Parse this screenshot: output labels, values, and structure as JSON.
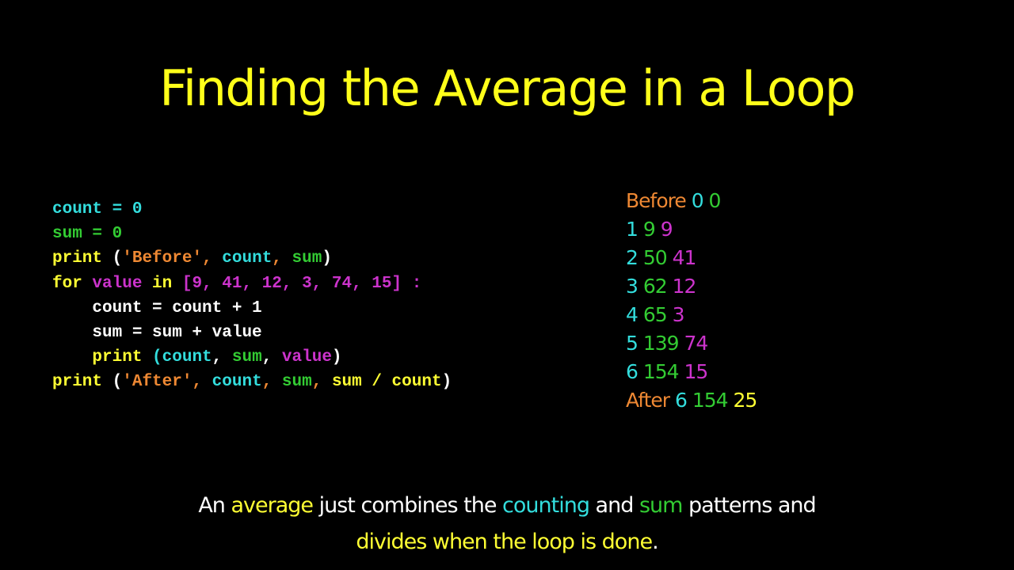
{
  "slide": {
    "title": "Finding the Average in a Loop"
  },
  "colors": {
    "title": "#ffff1a",
    "keyword": "#ffff33",
    "count": "#33dddd",
    "sum": "#33cc33",
    "string": "#ee8833",
    "value": "#cc33cc",
    "plain": "#ffffff"
  },
  "code": {
    "lines": [
      [
        {
          "t": "count = 0",
          "c": "cyan"
        }
      ],
      [
        {
          "t": "sum = 0",
          "c": "green"
        }
      ],
      [
        {
          "t": "print ",
          "c": "yellow"
        },
        {
          "t": "(",
          "c": "white"
        },
        {
          "t": "'Before'",
          "c": "orange"
        },
        {
          "t": ", ",
          "c": "orange"
        },
        {
          "t": "count",
          "c": "cyan"
        },
        {
          "t": ", ",
          "c": "orange"
        },
        {
          "t": "sum",
          "c": "green"
        },
        {
          "t": ")",
          "c": "white"
        }
      ],
      [
        {
          "t": "for ",
          "c": "yellow"
        },
        {
          "t": "value ",
          "c": "magenta"
        },
        {
          "t": "in ",
          "c": "yellow"
        },
        {
          "t": "[9, 41, 12, 3, 74, 15] :",
          "c": "magenta"
        }
      ],
      [
        {
          "t": "    count = count + 1",
          "c": "white"
        }
      ],
      [
        {
          "t": "    sum = sum + value",
          "c": "white"
        }
      ],
      [
        {
          "t": "    print ",
          "c": "yellow"
        },
        {
          "t": "(",
          "c": "cyan"
        },
        {
          "t": "count",
          "c": "cyan"
        },
        {
          "t": ", ",
          "c": "white"
        },
        {
          "t": "sum",
          "c": "green"
        },
        {
          "t": ", ",
          "c": "white"
        },
        {
          "t": "value",
          "c": "magenta"
        },
        {
          "t": ")",
          "c": "white"
        }
      ],
      [
        {
          "t": "print ",
          "c": "yellow"
        },
        {
          "t": "(",
          "c": "white"
        },
        {
          "t": "'After'",
          "c": "orange"
        },
        {
          "t": ", ",
          "c": "orange"
        },
        {
          "t": "count",
          "c": "cyan"
        },
        {
          "t": ", ",
          "c": "orange"
        },
        {
          "t": "sum",
          "c": "green"
        },
        {
          "t": ", ",
          "c": "orange"
        },
        {
          "t": "sum / count",
          "c": "yellow"
        },
        {
          "t": ")",
          "c": "white"
        }
      ]
    ]
  },
  "output": {
    "lines": [
      [
        {
          "t": "Before ",
          "c": "orange"
        },
        {
          "t": "0 ",
          "c": "cyan"
        },
        {
          "t": "0",
          "c": "green"
        }
      ],
      [
        {
          "t": "1 ",
          "c": "cyan"
        },
        {
          "t": "9 ",
          "c": "green"
        },
        {
          "t": "9",
          "c": "magenta"
        }
      ],
      [
        {
          "t": "2 ",
          "c": "cyan"
        },
        {
          "t": "50 ",
          "c": "green"
        },
        {
          "t": "41",
          "c": "magenta"
        }
      ],
      [
        {
          "t": "3 ",
          "c": "cyan"
        },
        {
          "t": "62 ",
          "c": "green"
        },
        {
          "t": "12",
          "c": "magenta"
        }
      ],
      [
        {
          "t": "4 ",
          "c": "cyan"
        },
        {
          "t": "65 ",
          "c": "green"
        },
        {
          "t": "3",
          "c": "magenta"
        }
      ],
      [
        {
          "t": "5 ",
          "c": "cyan"
        },
        {
          "t": "139 ",
          "c": "green"
        },
        {
          "t": "74",
          "c": "magenta"
        }
      ],
      [
        {
          "t": "6 ",
          "c": "cyan"
        },
        {
          "t": "154 ",
          "c": "green"
        },
        {
          "t": "15",
          "c": "magenta"
        }
      ],
      [
        {
          "t": "After ",
          "c": "orange"
        },
        {
          "t": "6 ",
          "c": "cyan"
        },
        {
          "t": "154 ",
          "c": "green"
        },
        {
          "t": "25",
          "c": "yellow"
        }
      ]
    ]
  },
  "footer": {
    "line1": [
      {
        "t": "An ",
        "c": "white"
      },
      {
        "t": "average",
        "c": "yellow"
      },
      {
        "t": " just combines the ",
        "c": "white"
      },
      {
        "t": "counting",
        "c": "cyan"
      },
      {
        "t": " and ",
        "c": "white"
      },
      {
        "t": "sum",
        "c": "green"
      },
      {
        "t": " patterns and",
        "c": "white"
      }
    ],
    "line2": [
      {
        "t": "divides when the loop is done",
        "c": "yellow"
      },
      {
        "t": ".",
        "c": "white"
      }
    ]
  }
}
